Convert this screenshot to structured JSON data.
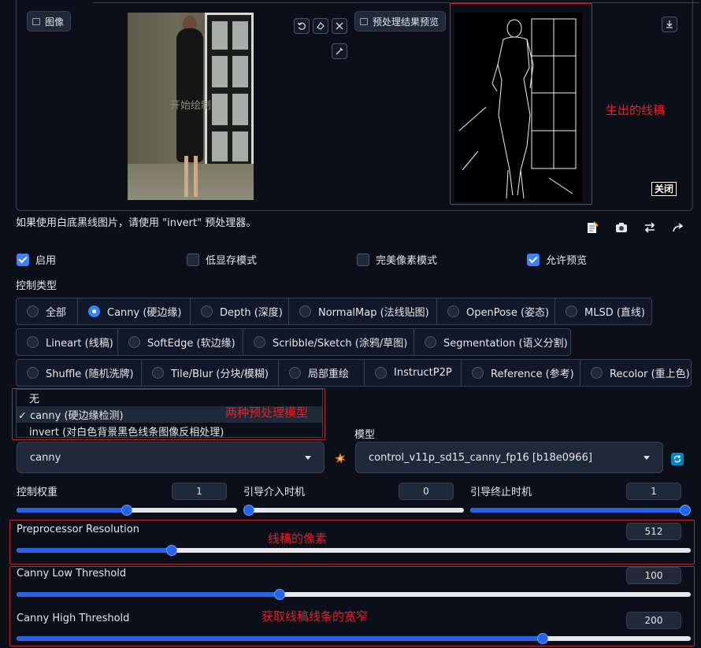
{
  "image_panel": {
    "input_label": "图像",
    "canvas_overlay": "开始绘制",
    "preview_label": "预处理结果预览",
    "close_label": "关闭"
  },
  "annotations": {
    "edge_result": "生出的线稿",
    "two_models": "两种预处理模型",
    "resolution": "线稿的像素",
    "thresholds": "获取线稿线条的宽窄"
  },
  "hint_text": "如果使用白底黑线图片，请使用 \"invert\" 预处理器。",
  "checkboxes": [
    {
      "label": "启用",
      "checked": true
    },
    {
      "label": "低显存模式",
      "checked": false
    },
    {
      "label": "完美像素模式",
      "checked": false
    },
    {
      "label": "允许预览",
      "checked": true
    }
  ],
  "control_type": {
    "label": "控制类型",
    "rows": [
      [
        "全部",
        "Canny (硬边缘)",
        "Depth (深度)",
        "NormalMap (法线贴图)",
        "OpenPose (姿态)",
        "MLSD (直线)"
      ],
      [
        "Lineart (线稿)",
        "SoftEdge (软边缘)",
        "Scribble/Sketch (涂鸦/草图)",
        "Segmentation (语义分割)"
      ],
      [
        "Shuffle (随机洗牌)",
        "Tile/Blur (分块/模糊)",
        "局部重绘",
        "InstructP2P",
        "Reference (参考)",
        "Recolor (重上色)"
      ]
    ],
    "selected": "Canny (硬边缘)"
  },
  "preprocessor": {
    "options": [
      "无",
      "canny (硬边缘检测)",
      "invert (对白色背景黑色线条图像反相处理)"
    ],
    "selected": "canny",
    "selected_marked": "✓ canny (硬边缘检测)"
  },
  "model": {
    "label": "模型",
    "selected": "control_v11p_sd15_canny_fp16 [b18e0966]"
  },
  "sliders": {
    "weight": {
      "label": "控制权重",
      "value": "1",
      "fraction": 0.5
    },
    "start": {
      "label": "引导介入时机",
      "value": "0",
      "fraction": 0.0
    },
    "end": {
      "label": "引导终止时机",
      "value": "1",
      "fraction": 1.0
    },
    "resolution": {
      "label": "Preprocessor Resolution",
      "value": "512",
      "fraction": 0.23
    },
    "low": {
      "label": "Canny Low Threshold",
      "value": "100",
      "fraction": 0.39
    },
    "high": {
      "label": "Canny High Threshold",
      "value": "200",
      "fraction": 0.78
    }
  },
  "colors": {
    "accent": "#2563eb",
    "annotation": "#e0242b"
  }
}
